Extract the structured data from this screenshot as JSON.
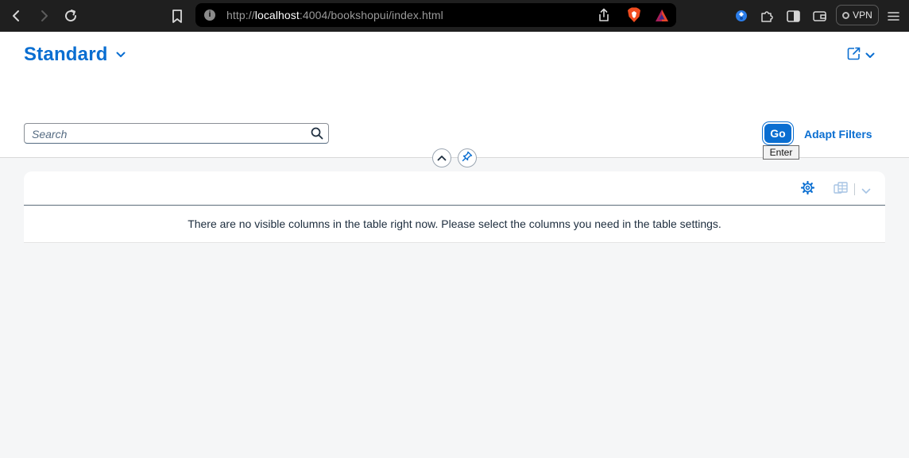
{
  "browser": {
    "url_scheme": "http://",
    "url_host": "localhost",
    "url_rest": ":4004/bookshopui/index.html",
    "vpn_label": "VPN",
    "icons": [
      "back-icon",
      "forward-icon",
      "reload-icon",
      "bookmark-icon",
      "site-info-icon",
      "share-icon",
      "brave-shield-icon",
      "brave-rewards-icon",
      "extension-icon",
      "puzzle-icon",
      "sidebar-icon",
      "wallet-icon",
      "menu-icon"
    ]
  },
  "header": {
    "variant_title": "Standard",
    "search_placeholder": "Search",
    "go_label": "Go",
    "adapt_filters_label": "Adapt Filters",
    "go_tooltip": "Enter"
  },
  "table": {
    "no_data_text": "There are no visible columns in the table right now. Please select the columns you need in the table settings."
  },
  "colors": {
    "accent": "#0a6ed1",
    "chrome_bg": "#1f1f1f",
    "page_bg": "#f5f6f7"
  }
}
